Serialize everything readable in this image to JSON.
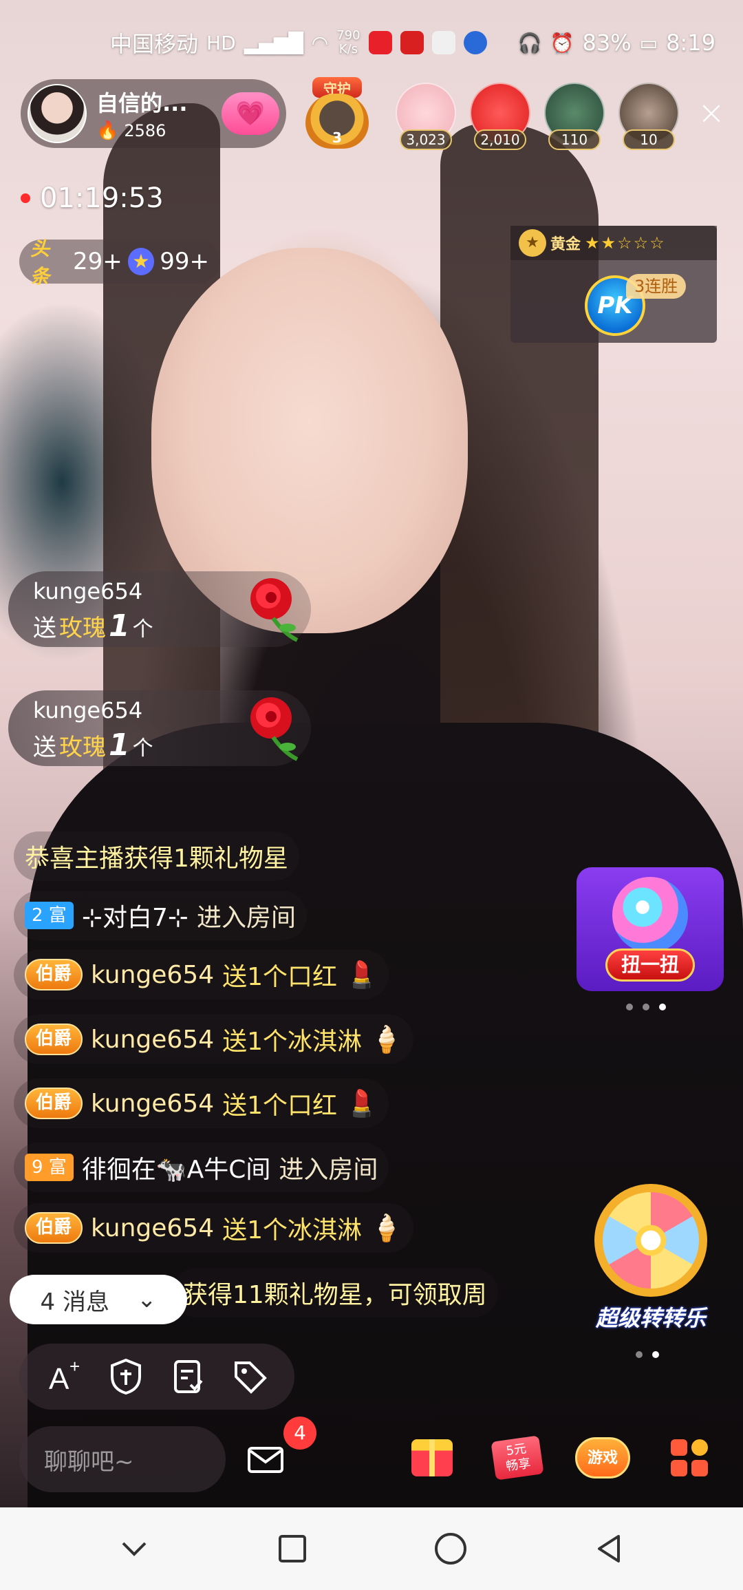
{
  "status_bar": {
    "carrier": "中国移动",
    "net_speed_value": "790",
    "net_speed_unit": "K/s",
    "battery": "83%",
    "time": "8:19"
  },
  "anchor": {
    "name": "自信的...",
    "heat": "2586"
  },
  "guard": {
    "label": "守护",
    "level": "3"
  },
  "top_viewers": [
    {
      "count": "3,023",
      "color": "#f3d3d6"
    },
    {
      "count": "2,010",
      "color": "#ff3b3b"
    },
    {
      "count": "110",
      "color": "#4a6a5a"
    },
    {
      "count": "10",
      "color": "#6a5a4a"
    }
  ],
  "live_timer": "01:19:53",
  "tags": {
    "toutiao_label": "头条",
    "toutiao_count": "29+",
    "star_count": "99+"
  },
  "pk": {
    "rank": "黄金",
    "stars": "★★☆☆☆",
    "pk_label": "PK",
    "streak": "3连胜"
  },
  "gift_notifications": [
    {
      "user": "kunge654",
      "send": "送",
      "gift": "玫瑰",
      "count": "1",
      "unit": "个"
    },
    {
      "user": "kunge654",
      "send": "送",
      "gift": "玫瑰",
      "count": "1",
      "unit": "个"
    }
  ],
  "chat": {
    "system_1": "恭喜主播获得1颗礼物星",
    "enter_1": {
      "rich_level": "2 富",
      "user": "⊹对白7⊹",
      "action": "进入房间"
    },
    "gift_1": {
      "noble": "伯爵",
      "user": "kunge654",
      "text": "送1个口红",
      "emoji": "💄"
    },
    "gift_2": {
      "noble": "伯爵",
      "user": "kunge654",
      "text": "送1个冰淇淋",
      "emoji": "🍦"
    },
    "gift_3": {
      "noble": "伯爵",
      "user": "kunge654",
      "text": "送1个口红",
      "emoji": "💄"
    },
    "enter_2": {
      "rich_level": "9 富",
      "user": "徘徊在🐄A牛C间",
      "action": "进入房间"
    },
    "gift_4": {
      "noble": "伯爵",
      "user": "kunge654",
      "text": "送1个冰淇淋",
      "emoji": "🍦"
    },
    "system_2": "获得11颗礼物星，可领取周"
  },
  "widgets": {
    "gacha_label": "扭一扭",
    "wheel_label": "超级转转乐"
  },
  "message_pill": {
    "label": "4 消息"
  },
  "bottom": {
    "input_placeholder": "聊聊吧~",
    "mail_badge": "4",
    "coupon_line1": "5元",
    "coupon_line2": "畅享",
    "game_label": "游戏"
  }
}
